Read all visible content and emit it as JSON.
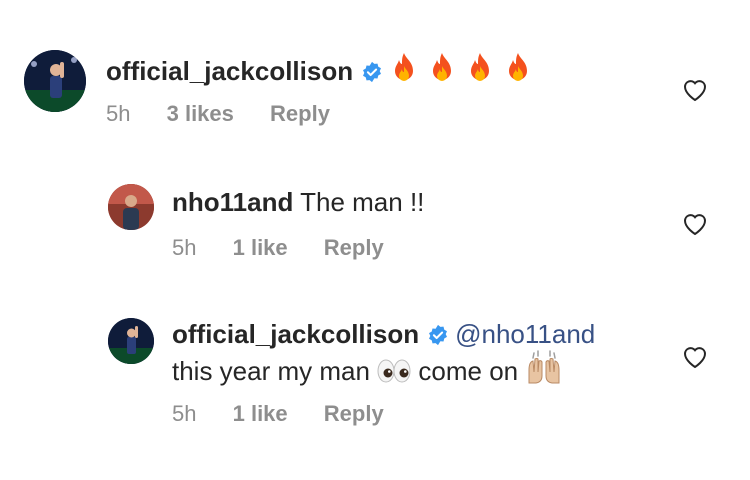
{
  "comments": [
    {
      "username": "official_jackcollison",
      "verified": true,
      "text": "",
      "emoji": [
        "fire",
        "fire",
        "fire",
        "fire"
      ],
      "time": "5h",
      "likes": "3 likes",
      "reply": "Reply"
    },
    {
      "username": "nho11and",
      "verified": false,
      "text": "The man !!",
      "time": "5h",
      "likes": "1 like",
      "reply": "Reply"
    },
    {
      "username": "official_jackcollison",
      "verified": true,
      "mention": "@nho11and",
      "text_line2_a": "this year my man",
      "emoji_1": "eyes",
      "text_line2_b": "come on",
      "emoji_2": "raising-hands",
      "time": "5h",
      "likes": "1 like",
      "reply": "Reply"
    }
  ],
  "colors": {
    "text": "#262626",
    "meta": "#8e8e8e",
    "verified_blue": "#3897f0",
    "mention": "#385185"
  }
}
